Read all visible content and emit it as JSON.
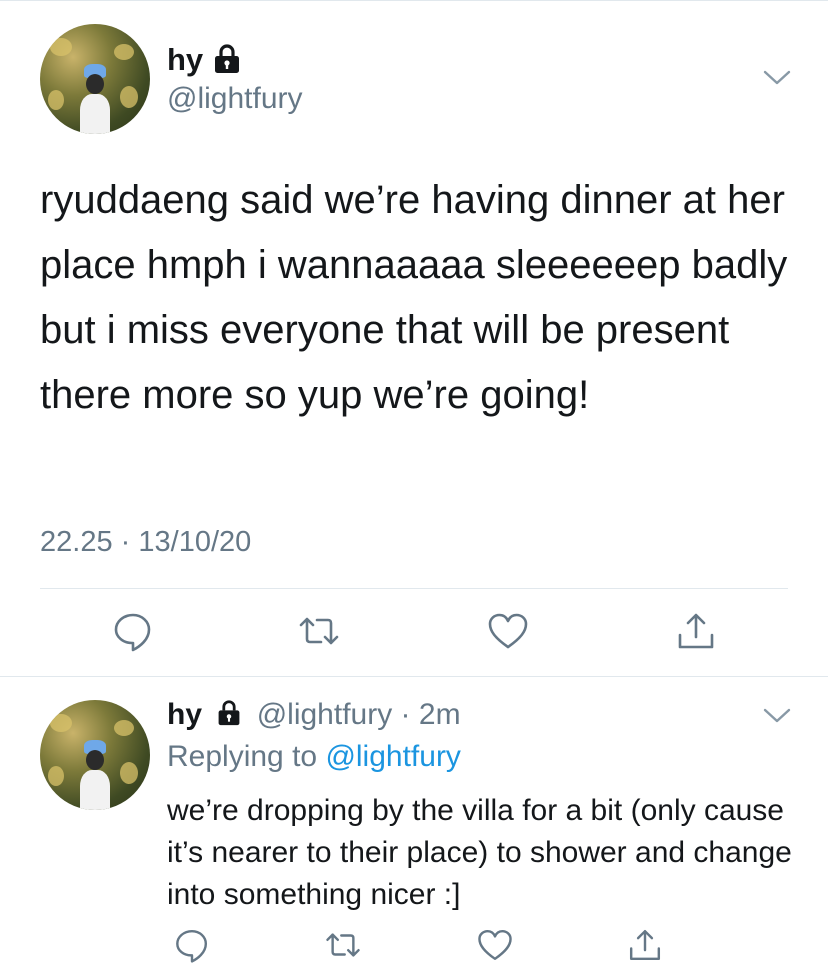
{
  "tweet": {
    "display_name": "hy",
    "handle": "@lightfury",
    "text": "ryuddaeng said we’re having dinner at her place hmph i wannaaaaa sleeeeeep badly but i miss everyone that will be present there more so yup we’re going!",
    "time": "22.25",
    "separator": "·",
    "date": "13/10/20",
    "icons": [
      "lock-icon",
      "chevron-down-icon",
      "reply-icon",
      "retweet-icon",
      "like-icon",
      "share-icon"
    ]
  },
  "reply": {
    "display_name": "hy",
    "handle": "@lightfury",
    "separator": "·",
    "age": "2m",
    "replying_prefix": "Replying to",
    "replying_to": "@lightfury",
    "text": "we’re dropping by the villa for a bit (only cause it’s nearer to their place) to shower and change into something nicer :]"
  },
  "colors": {
    "primary_text": "#14171a",
    "secondary_text": "#657786",
    "mention": "#1b95e0",
    "divider": "#e1e8ed"
  }
}
